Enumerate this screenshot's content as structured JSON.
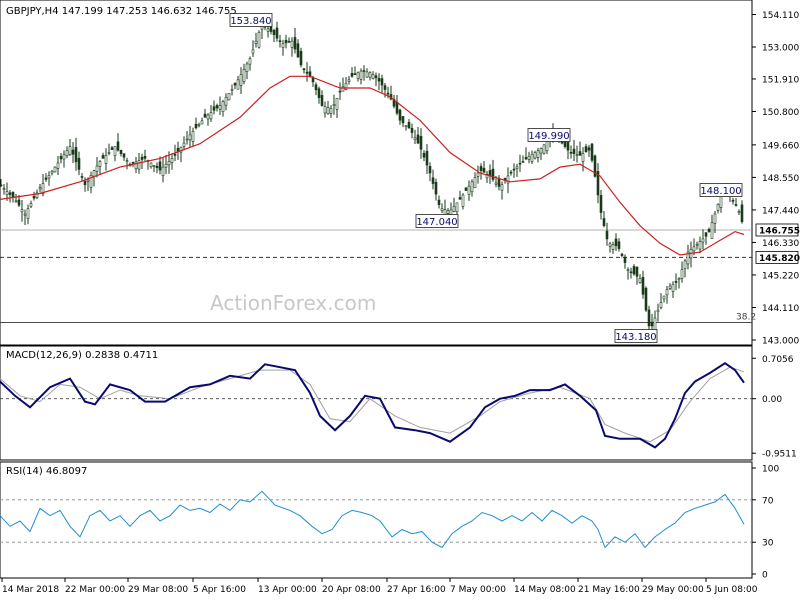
{
  "chart_data": {
    "type": "candlestick",
    "main": {
      "header": "GBPJPY,H4  147.199 147.253 146.632 146.755",
      "watermark": "ActionForex.com",
      "ylim": [
        143.0,
        154.4
      ],
      "yticks": [
        "154.110",
        "153.000",
        "151.910",
        "150.800",
        "149.660",
        "148.550",
        "147.440",
        "146.330",
        "145.220",
        "144.110",
        "143.000"
      ],
      "price_tag": "146.755",
      "price_level": 146.755,
      "support_tag": "145.820",
      "support_level": 145.82,
      "fib_label": "38.2",
      "fib_level": 143.6,
      "callouts": [
        {
          "text": "153.840",
          "price": 153.84
        },
        {
          "text": "147.040",
          "price": 147.04
        },
        {
          "text": "149.990",
          "price": 149.99
        },
        {
          "text": "148.100",
          "price": 148.1
        },
        {
          "text": "143.180",
          "price": 143.18
        }
      ],
      "close_path": [
        [
          0,
          148.3
        ],
        [
          15,
          147.8
        ],
        [
          25,
          147.3
        ],
        [
          40,
          148.2
        ],
        [
          55,
          148.9
        ],
        [
          70,
          149.6
        ],
        [
          85,
          148.3
        ],
        [
          100,
          149.1
        ],
        [
          115,
          149.6
        ],
        [
          130,
          149.0
        ],
        [
          145,
          149.2
        ],
        [
          160,
          148.8
        ],
        [
          175,
          149.3
        ],
        [
          190,
          150.0
        ],
        [
          205,
          150.6
        ],
        [
          220,
          151.0
        ],
        [
          235,
          151.7
        ],
        [
          250,
          152.6
        ],
        [
          262,
          153.8
        ],
        [
          272,
          153.5
        ],
        [
          282,
          153.1
        ],
        [
          292,
          153.2
        ],
        [
          302,
          152.3
        ],
        [
          312,
          151.9
        ],
        [
          322,
          151.0
        ],
        [
          332,
          150.9
        ],
        [
          342,
          151.6
        ],
        [
          352,
          152.0
        ],
        [
          362,
          152.2
        ],
        [
          372,
          152.1
        ],
        [
          380,
          151.8
        ],
        [
          390,
          151.3
        ],
        [
          400,
          150.5
        ],
        [
          410,
          150.2
        ],
        [
          420,
          149.6
        ],
        [
          430,
          148.7
        ],
        [
          440,
          147.5
        ],
        [
          450,
          147.4
        ],
        [
          460,
          147.8
        ],
        [
          470,
          148.3
        ],
        [
          480,
          148.8
        ],
        [
          490,
          148.6
        ],
        [
          500,
          148.2
        ],
        [
          510,
          148.7
        ],
        [
          520,
          149.0
        ],
        [
          530,
          149.3
        ],
        [
          540,
          149.5
        ],
        [
          550,
          149.9
        ],
        [
          560,
          149.8
        ],
        [
          570,
          149.4
        ],
        [
          580,
          149.3
        ],
        [
          590,
          149.5
        ],
        [
          596,
          148.4
        ],
        [
          600,
          147.5
        ],
        [
          608,
          146.3
        ],
        [
          618,
          146.2
        ],
        [
          628,
          145.4
        ],
        [
          640,
          145.1
        ],
        [
          650,
          143.3
        ],
        [
          660,
          144.2
        ],
        [
          668,
          144.8
        ],
        [
          678,
          145.0
        ],
        [
          688,
          146.0
        ],
        [
          698,
          146.3
        ],
        [
          708,
          146.6
        ],
        [
          716,
          147.4
        ],
        [
          722,
          148.1
        ],
        [
          730,
          147.9
        ],
        [
          738,
          147.5
        ],
        [
          744,
          146.8
        ]
      ],
      "ma_path": [
        [
          0,
          147.8
        ],
        [
          40,
          148.0
        ],
        [
          80,
          148.4
        ],
        [
          120,
          148.9
        ],
        [
          160,
          149.2
        ],
        [
          200,
          149.7
        ],
        [
          240,
          150.6
        ],
        [
          270,
          151.6
        ],
        [
          290,
          152.0
        ],
        [
          310,
          152.0
        ],
        [
          340,
          151.6
        ],
        [
          370,
          151.6
        ],
        [
          390,
          151.3
        ],
        [
          420,
          150.5
        ],
        [
          450,
          149.4
        ],
        [
          480,
          148.7
        ],
        [
          510,
          148.4
        ],
        [
          540,
          148.5
        ],
        [
          560,
          148.9
        ],
        [
          580,
          149.0
        ],
        [
          600,
          148.6
        ],
        [
          620,
          147.7
        ],
        [
          640,
          146.9
        ],
        [
          660,
          146.3
        ],
        [
          680,
          145.9
        ],
        [
          700,
          146.0
        ],
        [
          720,
          146.4
        ],
        [
          735,
          146.7
        ],
        [
          744,
          146.6
        ]
      ]
    },
    "macd": {
      "label": "MACD(12,26,9) 0.2838 0.4711",
      "ylim": [
        -1.0,
        0.85
      ],
      "yticks": [
        "0.7056",
        "0.00",
        "-0.9511"
      ],
      "zero": 0,
      "main_path": [
        [
          0,
          0.3
        ],
        [
          15,
          0.05
        ],
        [
          30,
          -0.15
        ],
        [
          50,
          0.2
        ],
        [
          70,
          0.35
        ],
        [
          85,
          -0.05
        ],
        [
          95,
          -0.1
        ],
        [
          110,
          0.25
        ],
        [
          130,
          0.15
        ],
        [
          145,
          -0.05
        ],
        [
          165,
          -0.05
        ],
        [
          190,
          0.2
        ],
        [
          210,
          0.25
        ],
        [
          230,
          0.4
        ],
        [
          250,
          0.35
        ],
        [
          265,
          0.6
        ],
        [
          280,
          0.55
        ],
        [
          295,
          0.5
        ],
        [
          310,
          0.1
        ],
        [
          320,
          -0.3
        ],
        [
          335,
          -0.55
        ],
        [
          350,
          -0.3
        ],
        [
          365,
          0.05
        ],
        [
          380,
          0.0
        ],
        [
          395,
          -0.5
        ],
        [
          415,
          -0.55
        ],
        [
          430,
          -0.6
        ],
        [
          450,
          -0.75
        ],
        [
          470,
          -0.5
        ],
        [
          485,
          -0.15
        ],
        [
          500,
          0.0
        ],
        [
          515,
          0.05
        ],
        [
          530,
          0.15
        ],
        [
          550,
          0.15
        ],
        [
          565,
          0.25
        ],
        [
          580,
          0.05
        ],
        [
          596,
          -0.2
        ],
        [
          605,
          -0.65
        ],
        [
          620,
          -0.7
        ],
        [
          640,
          -0.7
        ],
        [
          655,
          -0.85
        ],
        [
          665,
          -0.7
        ],
        [
          675,
          -0.35
        ],
        [
          685,
          0.1
        ],
        [
          695,
          0.3
        ],
        [
          710,
          0.45
        ],
        [
          725,
          0.62
        ],
        [
          735,
          0.5
        ],
        [
          744,
          0.28
        ]
      ],
      "signal_path": [
        [
          0,
          0.35
        ],
        [
          20,
          0.05
        ],
        [
          40,
          -0.05
        ],
        [
          60,
          0.25
        ],
        [
          80,
          0.2
        ],
        [
          100,
          0.0
        ],
        [
          120,
          0.15
        ],
        [
          140,
          0.05
        ],
        [
          170,
          0.0
        ],
        [
          200,
          0.2
        ],
        [
          230,
          0.35
        ],
        [
          260,
          0.5
        ],
        [
          290,
          0.5
        ],
        [
          310,
          0.25
        ],
        [
          330,
          -0.35
        ],
        [
          350,
          -0.4
        ],
        [
          370,
          0.0
        ],
        [
          395,
          -0.3
        ],
        [
          420,
          -0.5
        ],
        [
          450,
          -0.6
        ],
        [
          480,
          -0.3
        ],
        [
          500,
          -0.05
        ],
        [
          530,
          0.1
        ],
        [
          560,
          0.2
        ],
        [
          590,
          0.0
        ],
        [
          605,
          -0.45
        ],
        [
          625,
          -0.6
        ],
        [
          650,
          -0.75
        ],
        [
          670,
          -0.55
        ],
        [
          690,
          -0.05
        ],
        [
          710,
          0.35
        ],
        [
          730,
          0.55
        ],
        [
          744,
          0.47
        ]
      ]
    },
    "rsi": {
      "label": "RSI(14) 46.8097",
      "ylim": [
        0,
        100
      ],
      "yticks": [
        100,
        70,
        30,
        0
      ],
      "guides": [
        70,
        30
      ],
      "path": [
        [
          0,
          55
        ],
        [
          10,
          45
        ],
        [
          20,
          50
        ],
        [
          30,
          40
        ],
        [
          40,
          62
        ],
        [
          50,
          55
        ],
        [
          60,
          60
        ],
        [
          70,
          45
        ],
        [
          80,
          35
        ],
        [
          90,
          55
        ],
        [
          100,
          60
        ],
        [
          110,
          50
        ],
        [
          120,
          55
        ],
        [
          130,
          45
        ],
        [
          140,
          55
        ],
        [
          150,
          60
        ],
        [
          160,
          50
        ],
        [
          170,
          55
        ],
        [
          180,
          65
        ],
        [
          190,
          60
        ],
        [
          200,
          62
        ],
        [
          210,
          58
        ],
        [
          220,
          66
        ],
        [
          230,
          60
        ],
        [
          240,
          70
        ],
        [
          250,
          68
        ],
        [
          262,
          78
        ],
        [
          275,
          65
        ],
        [
          290,
          60
        ],
        [
          300,
          55
        ],
        [
          312,
          45
        ],
        [
          322,
          38
        ],
        [
          332,
          42
        ],
        [
          342,
          55
        ],
        [
          352,
          60
        ],
        [
          362,
          58
        ],
        [
          372,
          55
        ],
        [
          380,
          50
        ],
        [
          392,
          35
        ],
        [
          402,
          42
        ],
        [
          412,
          38
        ],
        [
          422,
          40
        ],
        [
          432,
          30
        ],
        [
          442,
          25
        ],
        [
          452,
          38
        ],
        [
          462,
          45
        ],
        [
          472,
          50
        ],
        [
          482,
          58
        ],
        [
          492,
          55
        ],
        [
          502,
          50
        ],
        [
          512,
          55
        ],
        [
          522,
          50
        ],
        [
          532,
          58
        ],
        [
          542,
          50
        ],
        [
          552,
          60
        ],
        [
          562,
          55
        ],
        [
          572,
          48
        ],
        [
          582,
          55
        ],
        [
          592,
          50
        ],
        [
          598,
          42
        ],
        [
          605,
          25
        ],
        [
          615,
          35
        ],
        [
          625,
          30
        ],
        [
          635,
          38
        ],
        [
          645,
          25
        ],
        [
          655,
          35
        ],
        [
          665,
          42
        ],
        [
          675,
          48
        ],
        [
          685,
          58
        ],
        [
          695,
          62
        ],
        [
          705,
          65
        ],
        [
          715,
          68
        ],
        [
          725,
          75
        ],
        [
          735,
          62
        ],
        [
          744,
          47
        ]
      ]
    },
    "x_labels": [
      "14 Mar 2018",
      "22 Mar 00:00",
      "29 Mar 08:00",
      "5 Apr 16:00",
      "13 Apr 00:00",
      "20 Apr 08:00",
      "27 Apr 16:00",
      "7 May 00:00",
      "14 May 08:00",
      "21 May 16:00",
      "29 May 00:00",
      "5 Jun 08:00"
    ],
    "colors": {
      "candle": "#1a3a1a",
      "ma": "#cc1f1f",
      "macd_main": "#0a0a6e",
      "macd_signal": "#a0a0a0",
      "rsi": "#1e8fd6",
      "callout_text": "#0a0a6e"
    }
  }
}
